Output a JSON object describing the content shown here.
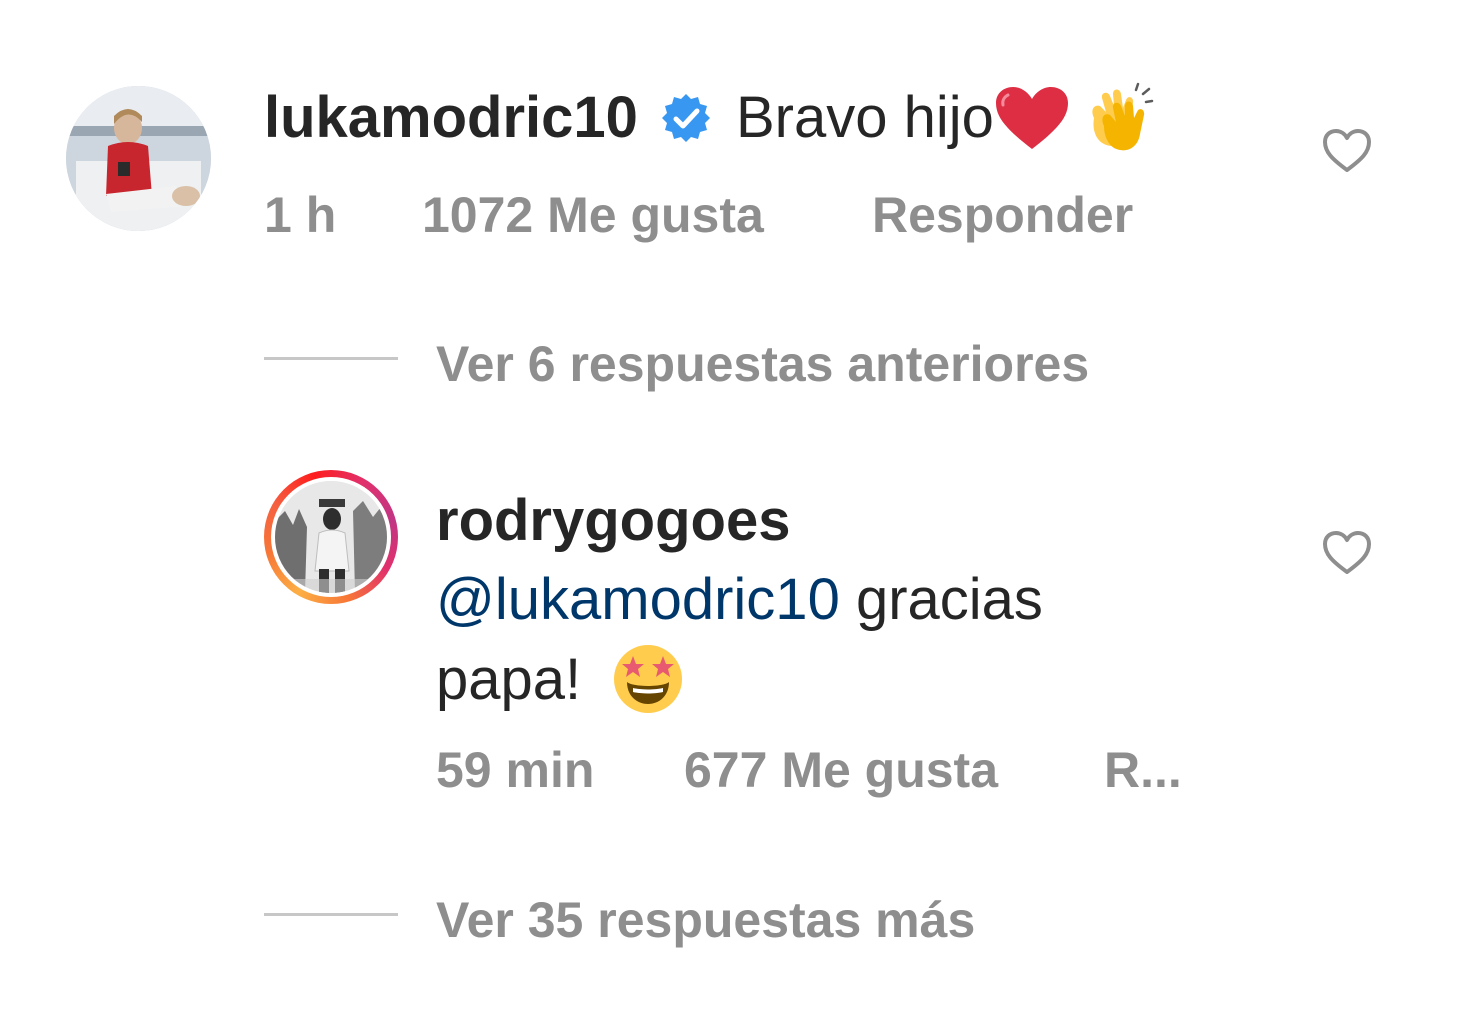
{
  "comment": {
    "username": "lukamodric10",
    "text": "Bravo hijo",
    "verified": true,
    "time": "1 h",
    "likes": "1072 Me gusta",
    "reply_label": "Responder"
  },
  "previous_replies": "Ver 6 respuestas anteriores",
  "reply": {
    "username": "rodrygogoes",
    "mention": "@lukamodric10",
    "text_after_mention": " gracias",
    "text_line2": "papa!",
    "time": "59 min",
    "likes": "677 Me gusta",
    "reply_label": "R..."
  },
  "more_replies": "Ver 35 respuestas más",
  "colors": {
    "text": "#262626",
    "meta": "#8e8e8e",
    "mention": "#00376b",
    "verified": "#3897f0",
    "divider": "#c7c7c7"
  },
  "icons": {
    "verified": "verified-badge-icon",
    "like": "heart-outline-icon",
    "emoji_heart": "red-heart-emoji",
    "emoji_clap": "clapping-hands-emoji",
    "emoji_star": "star-struck-emoji"
  }
}
